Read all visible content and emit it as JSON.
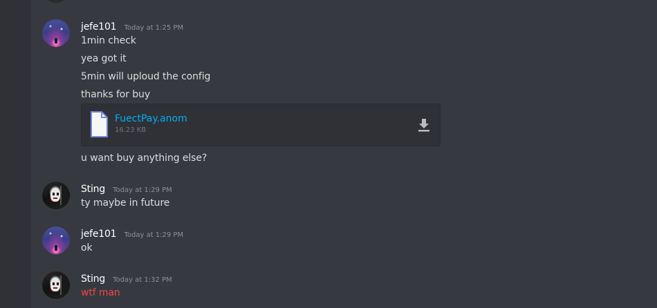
{
  "messages": [
    {
      "author": "jefe101",
      "avatar_icon": "galaxy-avatar",
      "timestamp": "Today at 1:25 PM",
      "lines": [
        "1min check",
        "yea got it",
        "5min will uploud the config",
        "thanks for buy"
      ],
      "attachment": {
        "name": "FuectPay.anom",
        "size": "16.23 KB",
        "icon": "file-icon",
        "action_icon": "download-icon"
      },
      "after_attachment": "u want buy anything else?"
    },
    {
      "author": "Sting",
      "avatar_icon": "joker-avatar",
      "timestamp": "Today at 1:29 PM",
      "lines": [
        "ty maybe in future"
      ]
    },
    {
      "author": "jefe101",
      "avatar_icon": "galaxy-avatar",
      "timestamp": "Today at 1:29 PM",
      "lines": [
        "ok"
      ]
    },
    {
      "author": "Sting",
      "avatar_icon": "joker-avatar",
      "timestamp": "Today at 1:32 PM",
      "lines": [
        "wtf man"
      ],
      "line_color": "#f04747"
    }
  ],
  "colors": {
    "background": "#36393f",
    "sidebar": "#2f3136",
    "link": "#00b0f4",
    "text": "#dcddde",
    "timestamp": "#8e9297",
    "red_text": "#f04747"
  }
}
